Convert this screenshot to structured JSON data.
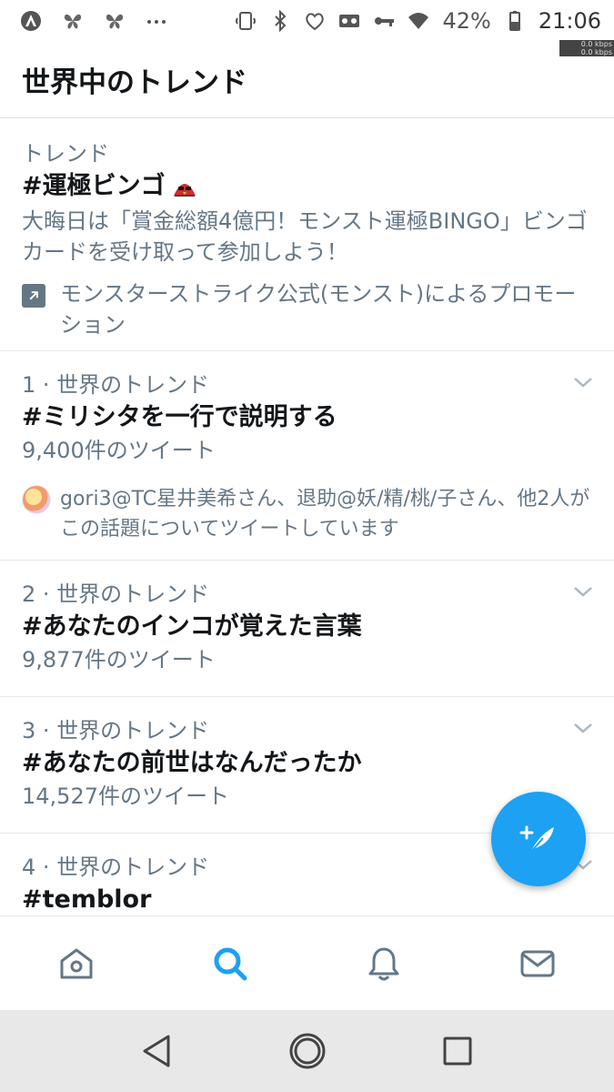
{
  "status_bar": {
    "battery": "42%",
    "time": "21:06",
    "net_speed_up": "0.0 kbps",
    "net_speed_down": "0.0 kbps",
    "icons": [
      "app-a-icon",
      "butterfly-icon",
      "butterfly-icon",
      "more-icon",
      "nfc-icon",
      "bluetooth-icon",
      "heart-pulse-icon",
      "voicemail-icon",
      "key-icon",
      "wifi-icon",
      "battery-icon"
    ]
  },
  "header": {
    "title": "世界中のトレンド"
  },
  "promoted": {
    "label": "トレンド",
    "name": "#運極ビンゴ",
    "description": "大晦日は「賞金総額4億円！モンスト運極BINGO」ビンゴカードを受け取って参加しよう！",
    "promotion": "モンスターストライク公式(モンスト)によるプロモーション"
  },
  "trends": [
    {
      "context": "1 · 世界のトレンド",
      "name": "#ミリシタを一行で説明する",
      "count": "9,400件のツイート",
      "social": "gori3@TC星井美希さん、退助@妖/精/桃/子さん、他2人がこの話題についてツイートしています"
    },
    {
      "context": "2 · 世界のトレンド",
      "name": "#あなたのインコが覚えた言葉",
      "count": "9,877件のツイート"
    },
    {
      "context": "3 · 世界のトレンド",
      "name": "#あなたの前世はなんだったか",
      "count": "14,527件のツイート"
    },
    {
      "context": "4 · 世界のトレンド",
      "name": "#temblor"
    }
  ],
  "bottom_nav": [
    "home-icon",
    "search-icon",
    "notifications-icon",
    "messages-icon"
  ],
  "colors": {
    "accent": "#1da1f2",
    "secondary_text": "#657786",
    "primary_text": "#14171a"
  }
}
